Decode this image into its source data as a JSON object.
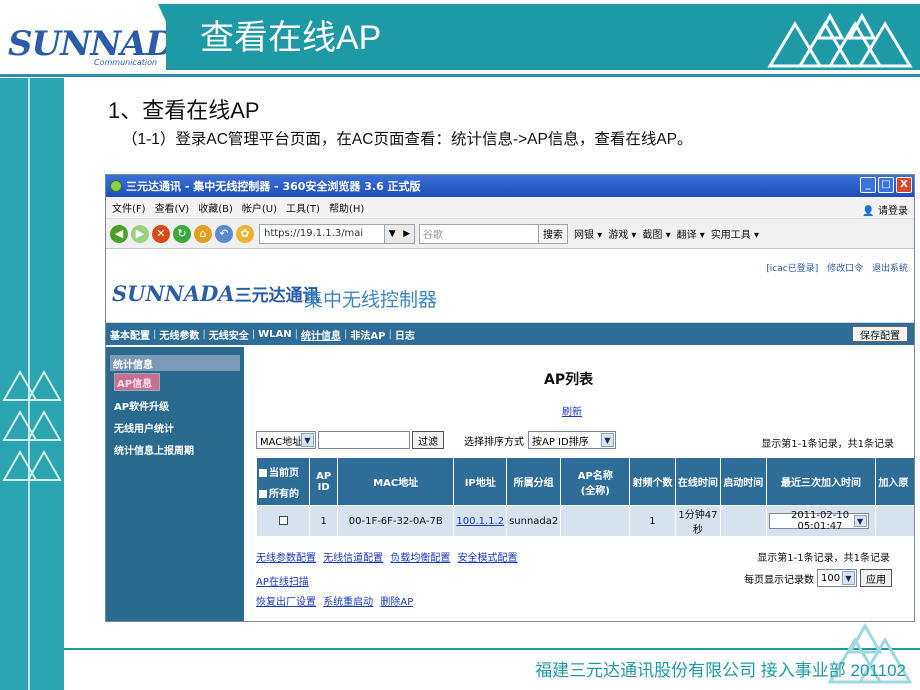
{
  "slide": {
    "logo_text": "SUNNADA",
    "logo_sub": "Communication",
    "title": "查看在线AP",
    "heading": "1、查看在线AP",
    "subheading": "（1-1）登录AC管理平台页面，在AC页面查看：统计信息->AP信息，查看在线AP。",
    "footer": "福建三元达通讯股份有限公司   接入事业部  201102"
  },
  "browser": {
    "window_title": "三元达通讯 - 集中无线控制器 - 360安全浏览器 3.6 正式版",
    "window_buttons": [
      "_",
      "□",
      "X"
    ],
    "menu": [
      "文件(F)",
      "查看(V)",
      "收藏(B)",
      "帐户(U)",
      "工具(T)",
      "帮助(H)"
    ],
    "login_hint": "请登录",
    "address": "https://19.1.1.3/mai",
    "search_placeholder": "谷歌",
    "search_button": "搜索",
    "toolbar_items": [
      "网银 ▾",
      "游戏 ▾",
      "截图 ▾",
      "翻译 ▾",
      "实用工具 ▾"
    ]
  },
  "app": {
    "logo": "SUNNADA",
    "logo_cn": "三元达通讯",
    "name": "集中无线控制器",
    "top_links": [
      "[icac已登录]",
      "修改口令",
      "退出系统"
    ],
    "nav": [
      "基本配置",
      "无线参数",
      "无线安全",
      "WLAN",
      "统计信息",
      "非法AP",
      "日志"
    ],
    "save_button": "保存配置",
    "sidebar": {
      "head": "统计信息",
      "items": [
        "AP信息",
        "AP软件升级",
        "无线用户统计",
        "统计信息上报周期"
      ]
    },
    "main": {
      "title": "AP列表",
      "refresh": "刷新",
      "filter_select": "MAC地址",
      "filter_button": "过滤",
      "sort_label": "选择排序方式",
      "sort_select": "按AP ID排序",
      "summary": "显示第1-1条记录，共1条记录",
      "table": {
        "headers": {
          "sel_current": "当前页",
          "sel_all": "所有的",
          "ap_id": "AP ID",
          "mac": "MAC地址",
          "ip": "IP地址",
          "group": "所属分组",
          "ap_name": "AP名称",
          "ap_name_all": "(全称)",
          "rf_count": "射频个数",
          "online_time": "在线时间",
          "start_time": "启动时间",
          "recent_join": "最近三次加入时间",
          "join_reason": "加入原"
        },
        "rows": [
          {
            "ap_id": "1",
            "mac": "00-1F-6F-32-0A-7B",
            "ip": "100.1.1.2",
            "group": "sunnada2",
            "ap_name": "",
            "rf_count": "1",
            "online_time": "1分钟47秒",
            "start_time": "",
            "recent_join": "2011-02-10 05:01:47"
          }
        ]
      },
      "links_row1": [
        "无线参数配置",
        "无线信道配置",
        "负载均衡配置",
        "安全模式配置"
      ],
      "link_scan": "AP在线扫描",
      "links_row3": [
        "恢复出厂设置",
        "系统重启动",
        "删除AP"
      ],
      "summary2": "显示第1-1条记录，共1条记录",
      "per_page_label": "每页显示记录数",
      "per_page_value": "100",
      "apply_button": "应用"
    }
  }
}
